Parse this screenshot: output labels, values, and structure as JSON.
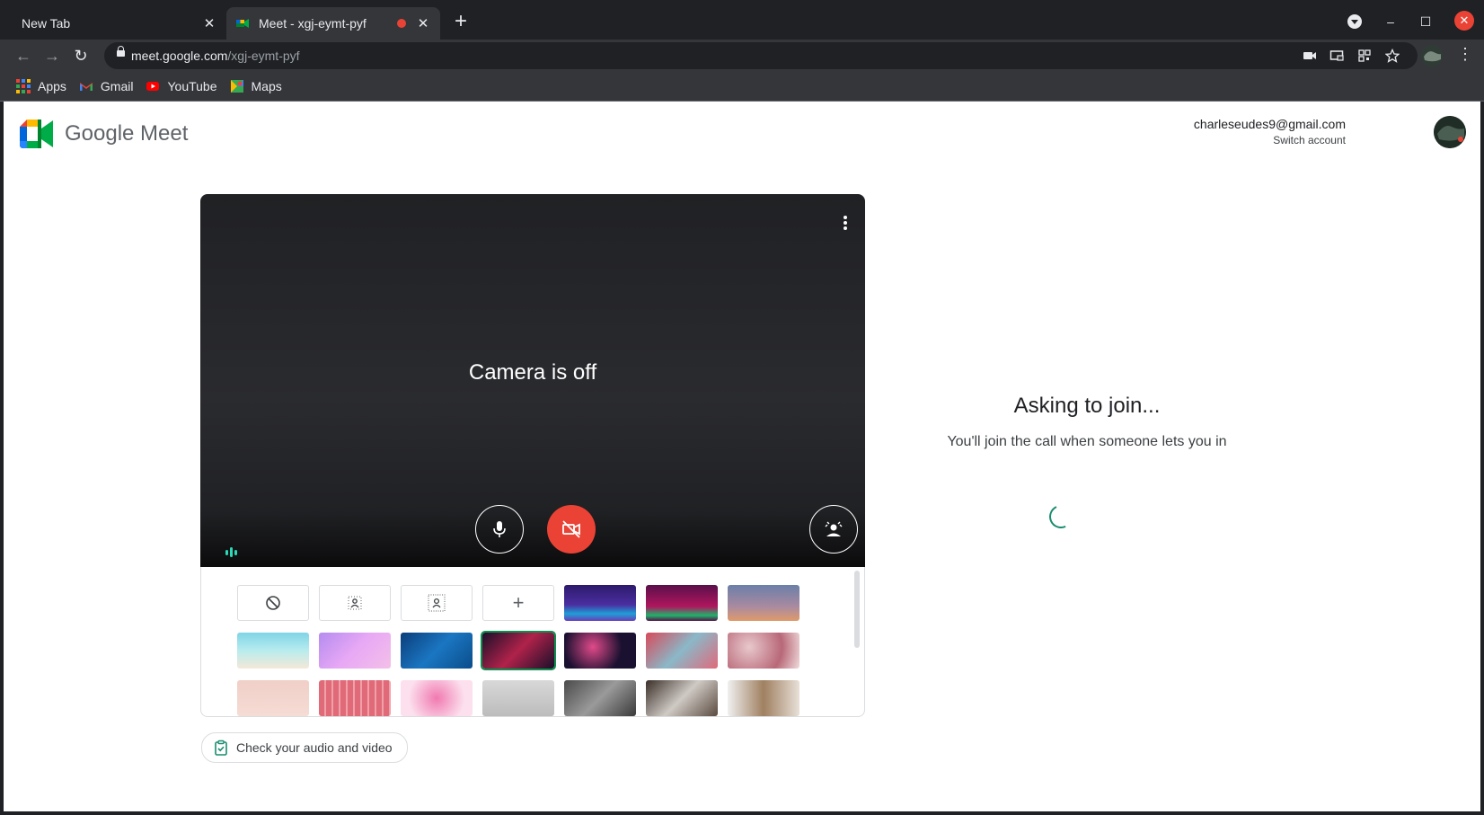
{
  "browser": {
    "tabs": [
      {
        "title": "New Tab",
        "active": false
      },
      {
        "title": "Meet - xgj-eymt-pyf",
        "active": true
      }
    ],
    "url_host": "meet.google.com",
    "url_path": "/xgj-eymt-pyf",
    "bookmarks": [
      {
        "label": "Apps",
        "icon": "apps-grid-icon"
      },
      {
        "label": "Gmail",
        "icon": "gmail-icon"
      },
      {
        "label": "YouTube",
        "icon": "youtube-icon"
      },
      {
        "label": "Maps",
        "icon": "maps-icon"
      }
    ]
  },
  "meet": {
    "logo_text": "Google Meet",
    "account_email": "charleseudes9@gmail.com",
    "switch_account": "Switch account",
    "camera_status": "Camera is off",
    "check_av": "Check your audio and video",
    "join_title": "Asking to join...",
    "join_message": "You'll join the call when someone lets you in"
  },
  "colors": {
    "accent_red": "#ea4335",
    "accent_teal": "#1a8c6f",
    "brand_green": "#00832d",
    "brand_blue": "#0066da",
    "brand_yellow": "#ffba00"
  }
}
